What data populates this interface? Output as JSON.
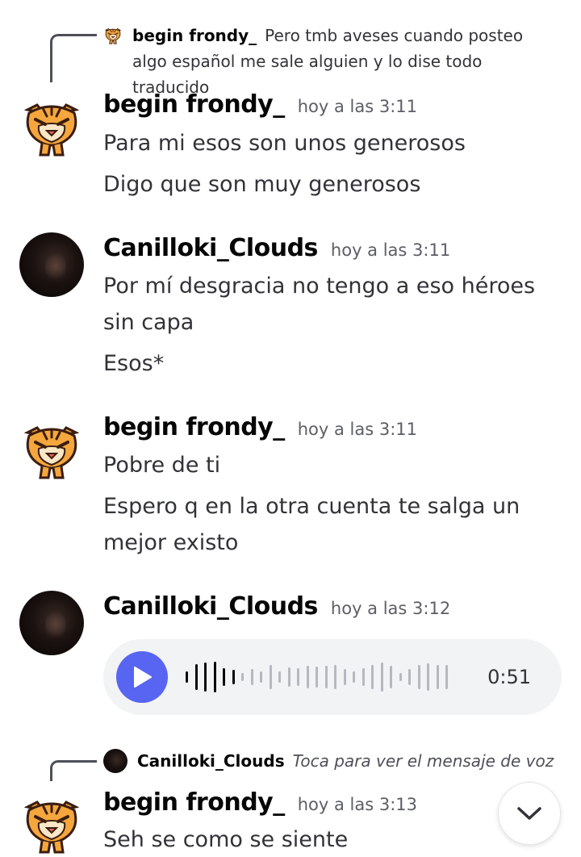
{
  "reply1": {
    "author": "begin frondy_",
    "text": "Pero tmb aveses cuando posteo algo español me sale alguien y lo dise todo traducido"
  },
  "messages": [
    {
      "author": "begin frondy_",
      "time": "hoy a las 3:11",
      "lines": [
        "Para mi esos son unos generosos",
        "Digo que son muy generosos"
      ]
    },
    {
      "author": "Canilloki_Clouds",
      "time": "hoy a las 3:11",
      "lines": [
        "Por mí desgracia no tengo a eso héroes sin capa",
        "Esos*"
      ]
    },
    {
      "author": "begin frondy_",
      "time": "hoy a las 3:11",
      "lines": [
        "Pobre de ti",
        "Espero q en la otra cuenta te salga un mejor existo"
      ]
    },
    {
      "author": "Canilloki_Clouds",
      "time": "hoy a las 3:12",
      "voice": {
        "duration": "0:51",
        "progress": 0.1
      }
    },
    {
      "author": "begin frondy_",
      "time": "hoy a las 3:13",
      "lines": [
        "Seh se como se siente"
      ]
    }
  ],
  "reply2": {
    "author": "Canilloki_Clouds",
    "text": "Toca para ver el mensaje de voz"
  },
  "icons": {
    "tiger_avatar": "tiger-avatar-icon",
    "dark_avatar": "dark-avatar-icon",
    "play": "play-icon",
    "scroll_down": "chevron-down-icon"
  },
  "colors": {
    "accent": "#5865f2",
    "text": "#313338",
    "muted": "#5c5e66"
  }
}
